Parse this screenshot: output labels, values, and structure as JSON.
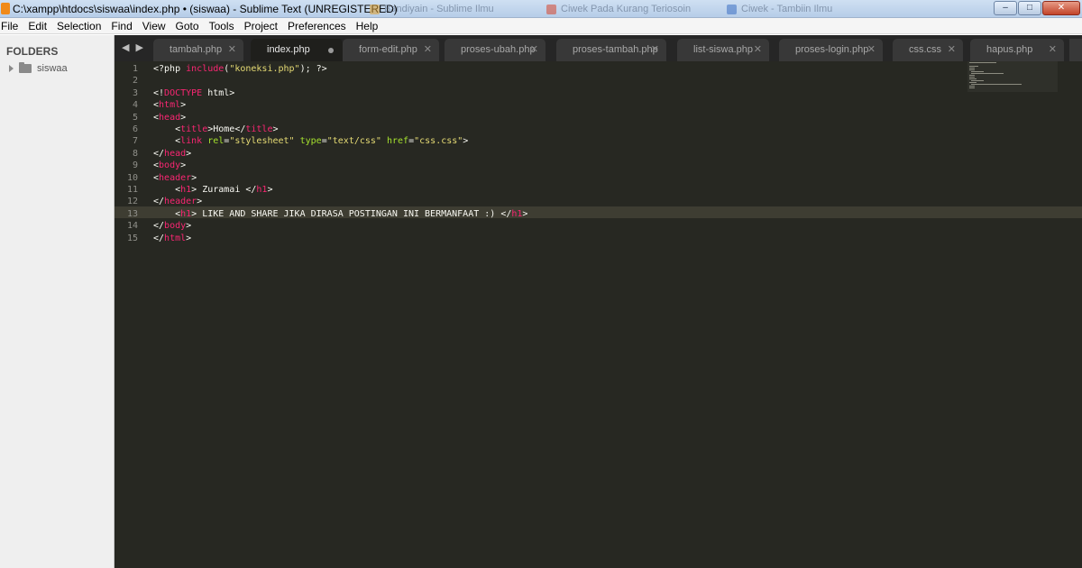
{
  "window": {
    "title": "C:\\xampp\\htdocs\\siswaa\\index.php • (siswaa) - Sublime Text (UNREGISTERED)",
    "background_tabs": [
      "Bandiyain - Sublime Ilmu",
      "Ciwek Pada Kurang Teriosoin",
      "Ciwek - Tambiin Ilmu"
    ],
    "buttons": {
      "minimize": "–",
      "maximize": "□",
      "close": "✕"
    }
  },
  "menu": [
    "File",
    "Edit",
    "Selection",
    "Find",
    "View",
    "Goto",
    "Tools",
    "Project",
    "Preferences",
    "Help"
  ],
  "sidebar": {
    "heading": "FOLDERS",
    "folders": [
      {
        "name": "siswaa",
        "icon": "folder-icon"
      }
    ]
  },
  "tabs": {
    "nav": "◀ ▶",
    "items": [
      {
        "label": "tambah.php",
        "close": "✕"
      },
      {
        "label": "index.php",
        "active": true,
        "dirty": true
      },
      {
        "label": "form-edit.php",
        "close": "✕"
      },
      {
        "label": "proses-ubah.php",
        "close": "✕"
      },
      {
        "label": "proses-tambah.php",
        "close": "✕"
      },
      {
        "label": "list-siswa.php",
        "close": "✕"
      },
      {
        "label": "proses-login.php",
        "close": "✕"
      },
      {
        "label": "css.css",
        "close": "✕"
      },
      {
        "label": "hapus.php",
        "close": "✕"
      }
    ]
  },
  "editor": {
    "current_line": 13,
    "theme_colors": {
      "background": "#272822",
      "text": "#f8f8f2",
      "keyword": "#f92672",
      "string": "#e6db74",
      "attribute": "#a6e22e"
    },
    "lines": [
      {
        "n": "1",
        "tokens": [
          [
            "t",
            "<?php "
          ],
          [
            "kw",
            "include"
          ],
          [
            "t",
            "("
          ],
          [
            "str",
            "\"koneksi.php\""
          ],
          [
            "t",
            "); ?>"
          ]
        ]
      },
      {
        "n": "2",
        "tokens": []
      },
      {
        "n": "3",
        "tokens": [
          [
            "t",
            "<!"
          ],
          [
            "kw",
            "DOCTYPE"
          ],
          [
            "t",
            " html>"
          ]
        ]
      },
      {
        "n": "4",
        "tokens": [
          [
            "t",
            "<"
          ],
          [
            "kw",
            "html"
          ],
          [
            "t",
            ">"
          ]
        ]
      },
      {
        "n": "5",
        "tokens": [
          [
            "t",
            "<"
          ],
          [
            "kw",
            "head"
          ],
          [
            "t",
            ">"
          ]
        ]
      },
      {
        "n": "6",
        "tokens": [
          [
            "t",
            "    <"
          ],
          [
            "kw",
            "title"
          ],
          [
            "t",
            ">Home</"
          ],
          [
            "kw",
            "title"
          ],
          [
            "t",
            ">"
          ]
        ]
      },
      {
        "n": "7",
        "tokens": [
          [
            "t",
            "    <"
          ],
          [
            "kw",
            "link"
          ],
          [
            "t",
            " "
          ],
          [
            "at",
            "rel"
          ],
          [
            "t",
            "="
          ],
          [
            "str",
            "\"stylesheet\""
          ],
          [
            "t",
            " "
          ],
          [
            "at",
            "type"
          ],
          [
            "t",
            "="
          ],
          [
            "str",
            "\"text/css\""
          ],
          [
            "t",
            " "
          ],
          [
            "at",
            "href"
          ],
          [
            "t",
            "="
          ],
          [
            "str",
            "\"css.css\""
          ],
          [
            "t",
            ">"
          ]
        ]
      },
      {
        "n": "8",
        "tokens": [
          [
            "t",
            "</"
          ],
          [
            "kw",
            "head"
          ],
          [
            "t",
            ">"
          ]
        ]
      },
      {
        "n": "9",
        "tokens": [
          [
            "t",
            "<"
          ],
          [
            "kw",
            "body"
          ],
          [
            "t",
            ">"
          ]
        ]
      },
      {
        "n": "10",
        "tokens": [
          [
            "t",
            "<"
          ],
          [
            "kw",
            "header"
          ],
          [
            "t",
            ">"
          ]
        ]
      },
      {
        "n": "11",
        "tokens": [
          [
            "t",
            "    <"
          ],
          [
            "kw",
            "h1"
          ],
          [
            "t",
            "> Zuramai </"
          ],
          [
            "kw",
            "h1"
          ],
          [
            "t",
            ">"
          ]
        ]
      },
      {
        "n": "12",
        "tokens": [
          [
            "t",
            "</"
          ],
          [
            "kw",
            "header"
          ],
          [
            "t",
            ">"
          ]
        ]
      },
      {
        "n": "13",
        "tokens": [
          [
            "t",
            "    <"
          ],
          [
            "kw",
            "h1"
          ],
          [
            "t",
            "> LIKE AND SHARE JIKA DIRASA POSTINGAN INI BERMANFAAT :) </"
          ],
          [
            "kw",
            "h1"
          ],
          [
            "t",
            ">"
          ]
        ]
      },
      {
        "n": "14",
        "tokens": [
          [
            "t",
            "</"
          ],
          [
            "kw",
            "body"
          ],
          [
            "t",
            ">"
          ]
        ]
      },
      {
        "n": "15",
        "tokens": [
          [
            "t",
            "</"
          ],
          [
            "kw",
            "html"
          ],
          [
            "t",
            ">"
          ]
        ]
      }
    ]
  }
}
